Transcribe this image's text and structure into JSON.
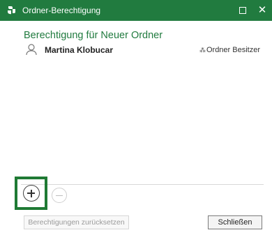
{
  "window": {
    "title": "Ordner-Berechtigung",
    "close_glyph": "✕"
  },
  "dialog": {
    "heading": "Berechtigung für Neuer Ordner",
    "permissions": [
      {
        "user": "Martina Klobucar",
        "role": "Ordner Besitzer",
        "icon": "user-icon"
      }
    ]
  },
  "buttons": {
    "add_icon": "plus-circle-icon",
    "remove_icon": "minus-circle-icon",
    "reset_label": "Berechtigungen zurücksetzen",
    "close_label": "Schließen"
  },
  "colors": {
    "accent": "#217b3f",
    "highlight": "#1f7a34"
  }
}
